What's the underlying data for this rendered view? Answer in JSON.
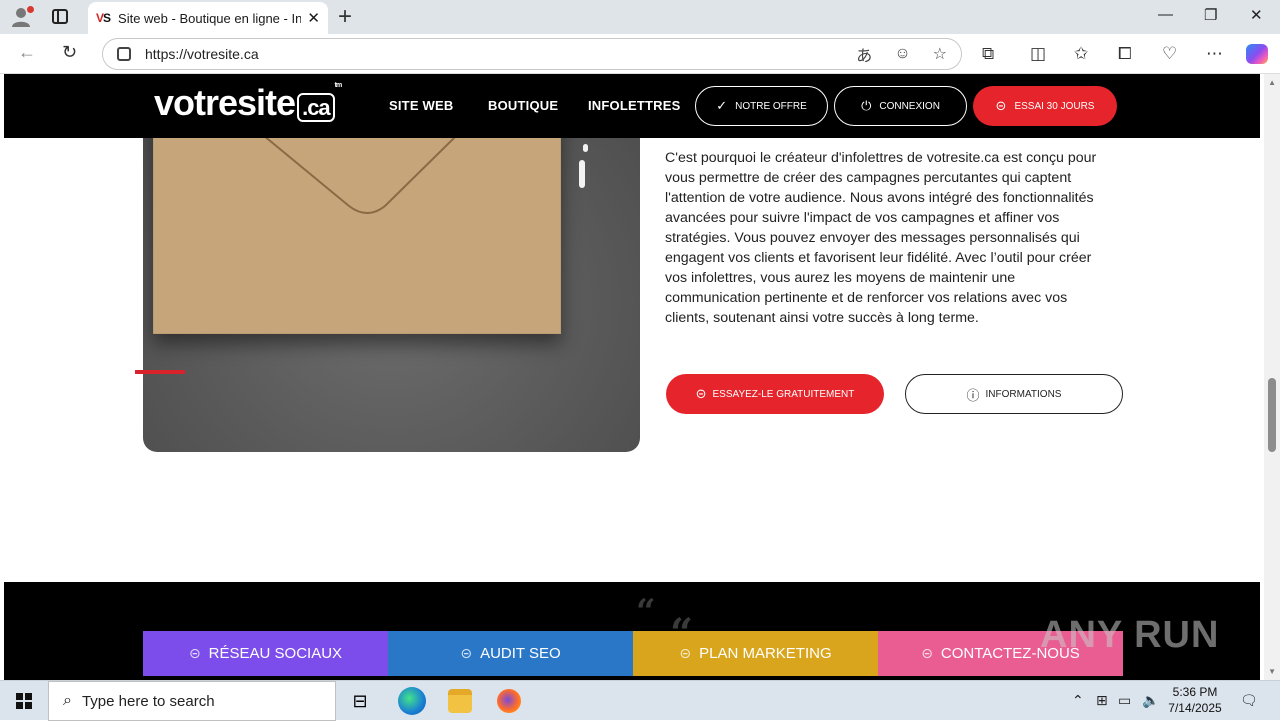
{
  "browser": {
    "tab_title": "Site web - Boutique en ligne - Info",
    "tab_favicon": "VS",
    "url": "https://votresite.ca"
  },
  "site": {
    "logo_text": "votresite",
    "logo_suffix": ".ca",
    "logo_tm": "tm",
    "nav": [
      "SITE WEB",
      "BOUTIQUE",
      "INFOLETTRES"
    ],
    "buttons": {
      "offer": "NOTRE OFFRE",
      "login": "CONNEXION",
      "trial": "ESSAI 30 JOURS"
    }
  },
  "content": {
    "paragraph": "C'est pourquoi le créateur d'infolettres de votresite.ca est conçu pour vous permettre de créer des campagnes percutantes qui captent l'attention de votre audience. Nous avons intégré des fonctionnalités avancées pour suivre l'impact de vos campagnes et affiner vos stratégies. Vous pouvez envoyer des messages personnalisés qui engagent vos clients et favorisent leur fidélité. Avec l’outil pour créer vos infolettres, vous aurez les moyens de maintenir une communication pertinente et de renforcer vos relations avec vos clients, soutenant ainsi votre succès à long terme.",
    "cta_try": "ESSAYEZ-LE GRATUITEMENT",
    "cta_info": "INFORMATIONS"
  },
  "bottom_bar": [
    {
      "label": "RÉSEAU SOCIAUX",
      "color": "#7c4dea"
    },
    {
      "label": "AUDIT SEO",
      "color": "#2a77c7"
    },
    {
      "label": "PLAN MARKETING",
      "color": "#d8a51c"
    },
    {
      "label": "CONTACTEZ-NOUS",
      "color": "#ea5d92"
    }
  ],
  "watermark": "ANY RUN",
  "taskbar": {
    "search_placeholder": "Type here to search",
    "time": "5:36 PM",
    "date": "7/14/2025"
  },
  "colors": {
    "brand_red": "#e6242b",
    "header_bg": "#000000"
  }
}
